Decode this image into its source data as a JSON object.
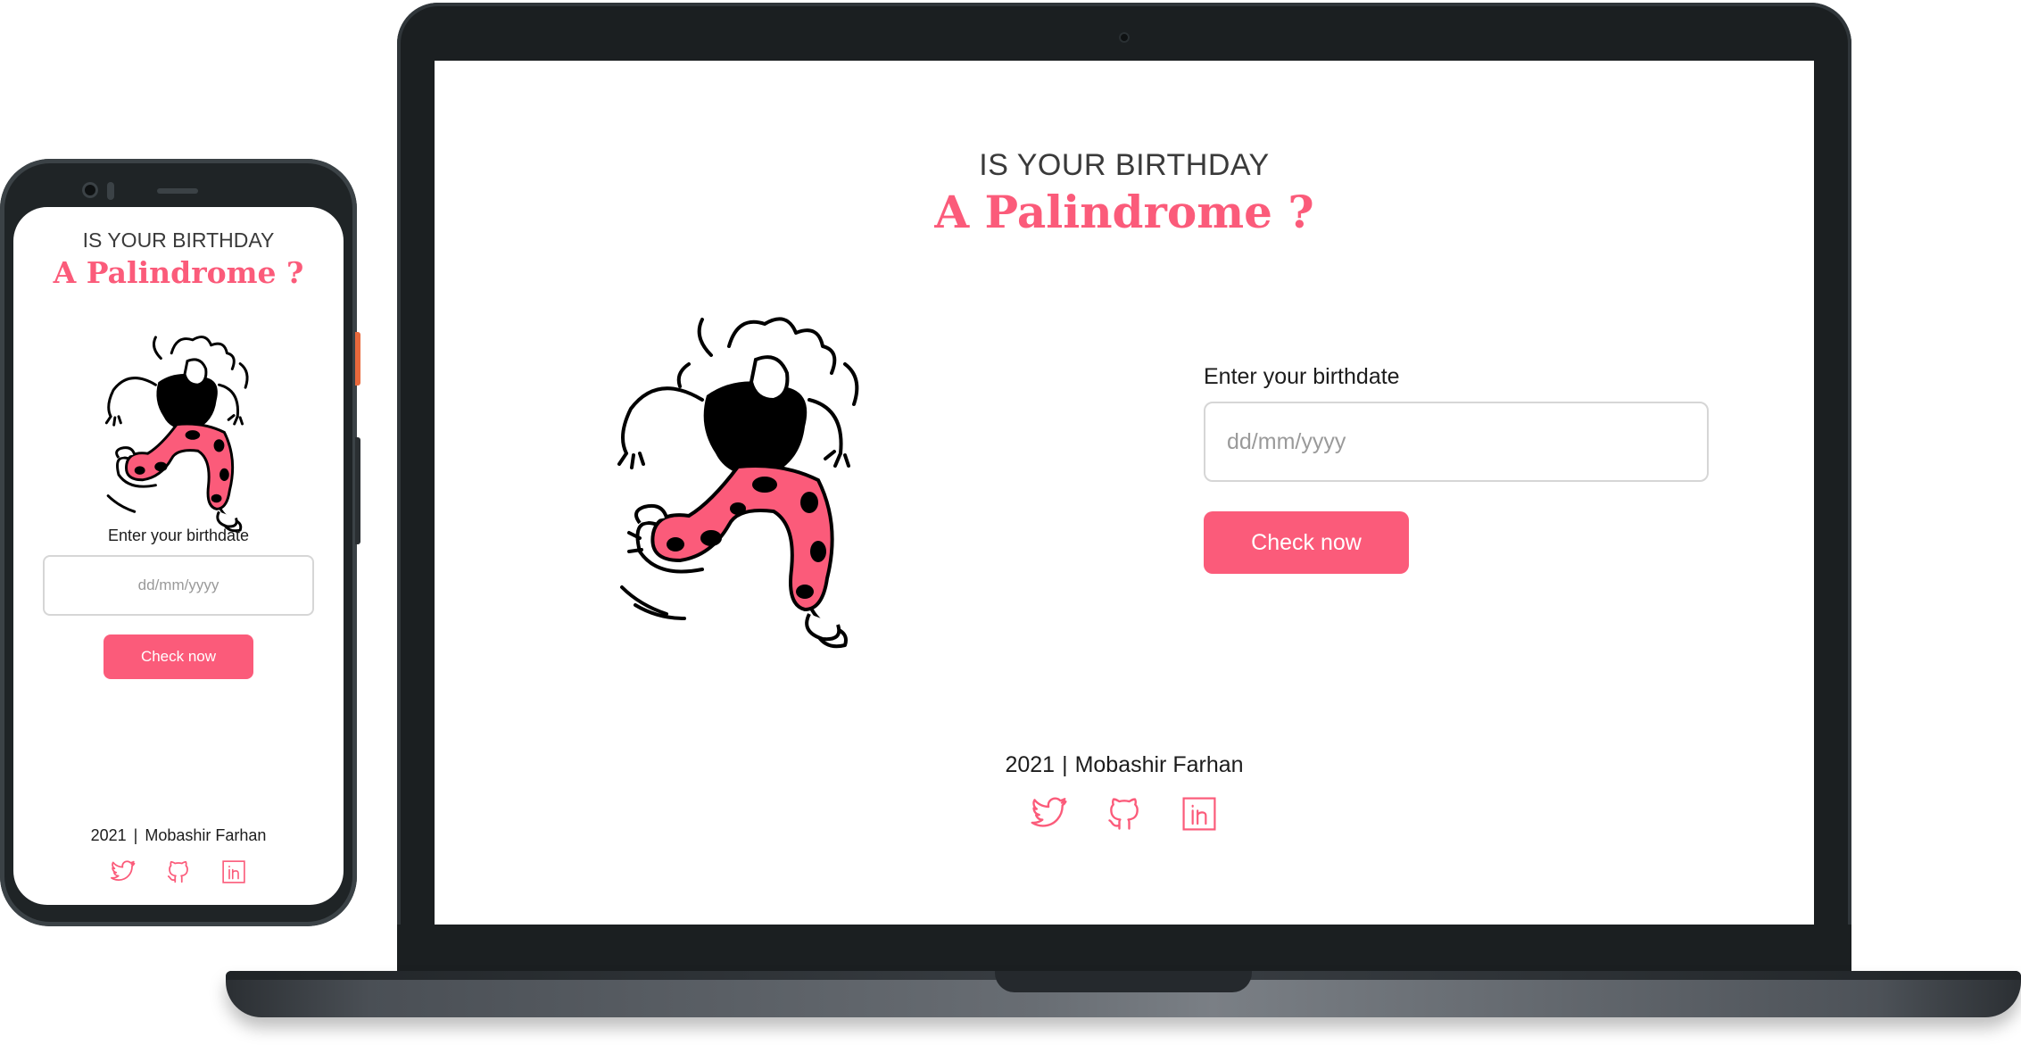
{
  "app": {
    "kicker": "IS YOUR BIRTHDAY",
    "title": "A Palindrome ?",
    "input_label": "Enter your birthdate",
    "input_placeholder": "dd/mm/yyyy",
    "button_label": "Check now",
    "footer_year": "2021",
    "footer_separator": "|",
    "footer_author": "Mobashir Farhan",
    "social_icons": [
      "twitter-icon",
      "github-icon",
      "linkedin-icon"
    ]
  },
  "colors": {
    "accent": "#fb5b7a",
    "text": "#1c1c1c",
    "device_frame": "#1b1f21",
    "input_border": "#d6d6d6"
  }
}
